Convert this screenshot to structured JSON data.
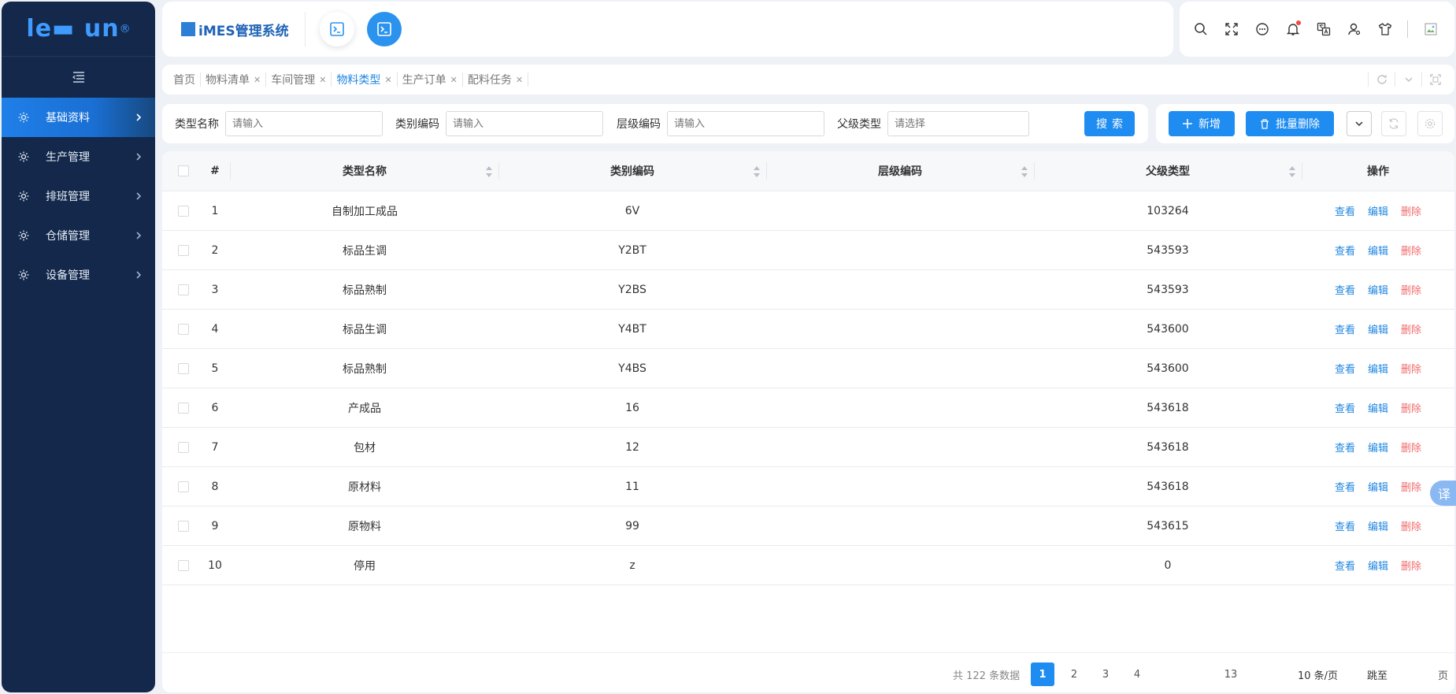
{
  "logo": {
    "text": "le▬ un",
    "sup": "®"
  },
  "sidebar": {
    "items": [
      {
        "label": "基础资料",
        "icon": "gear-icon"
      },
      {
        "label": "生产管理",
        "icon": "gear-icon"
      },
      {
        "label": "排班管理",
        "icon": "gear-icon"
      },
      {
        "label": "仓储管理",
        "icon": "gear-icon"
      },
      {
        "label": "设备管理",
        "icon": "gear-icon"
      }
    ]
  },
  "header": {
    "title": "iMES管理系统"
  },
  "tabs": [
    {
      "label": "首页",
      "closable": false
    },
    {
      "label": "物料清单",
      "closable": true
    },
    {
      "label": "车间管理",
      "closable": true
    },
    {
      "label": "物料类型",
      "closable": true
    },
    {
      "label": "生产订单",
      "closable": true
    },
    {
      "label": "配料任务",
      "closable": true
    }
  ],
  "search": {
    "name_label": "类型名称",
    "name_placeholder": "请输入",
    "type_code_label": "类别编码",
    "type_code_placeholder": "请输入",
    "level_code_label": "层级编码",
    "level_code_placeholder": "请输入",
    "parent_label": "父级类型",
    "parent_placeholder": "请选择",
    "search_button": "搜索"
  },
  "actions": {
    "add_label": "新增",
    "batch_delete_label": "批量删除"
  },
  "table": {
    "headers": {
      "idx": "#",
      "name": "类型名称",
      "type_code": "类别编码",
      "level_code": "层级编码",
      "parent": "父级类型",
      "ops": "操作"
    },
    "op_labels": {
      "view": "查看",
      "edit": "编辑",
      "delete": "删除"
    },
    "rows": [
      {
        "idx": "1",
        "name": "自制加工成品",
        "type_code": "6V",
        "level_code": "",
        "parent": "103264"
      },
      {
        "idx": "2",
        "name": "标品生调",
        "type_code": "Y2BT",
        "level_code": "",
        "parent": "543593"
      },
      {
        "idx": "3",
        "name": "标品熟制",
        "type_code": "Y2BS",
        "level_code": "",
        "parent": "543593"
      },
      {
        "idx": "4",
        "name": "标品生调",
        "type_code": "Y4BT",
        "level_code": "",
        "parent": "543600"
      },
      {
        "idx": "5",
        "name": "标品熟制",
        "type_code": "Y4BS",
        "level_code": "",
        "parent": "543600"
      },
      {
        "idx": "6",
        "name": "产成品",
        "type_code": "16",
        "level_code": "",
        "parent": "543618"
      },
      {
        "idx": "7",
        "name": "包材",
        "type_code": "12",
        "level_code": "",
        "parent": "543618"
      },
      {
        "idx": "8",
        "name": "原材料",
        "type_code": "11",
        "level_code": "",
        "parent": "543618"
      },
      {
        "idx": "9",
        "name": "原物料",
        "type_code": "99",
        "level_code": "",
        "parent": "543615"
      },
      {
        "idx": "10",
        "name": "停用",
        "type_code": "z",
        "level_code": "",
        "parent": "0"
      }
    ]
  },
  "pagination": {
    "total": "共 122 条数据",
    "pages": [
      "1",
      "2",
      "3",
      "4",
      "13"
    ],
    "page_size": "10 条/页",
    "jump": "跳至",
    "page_suffix": "页"
  },
  "translate_badge": "译"
}
